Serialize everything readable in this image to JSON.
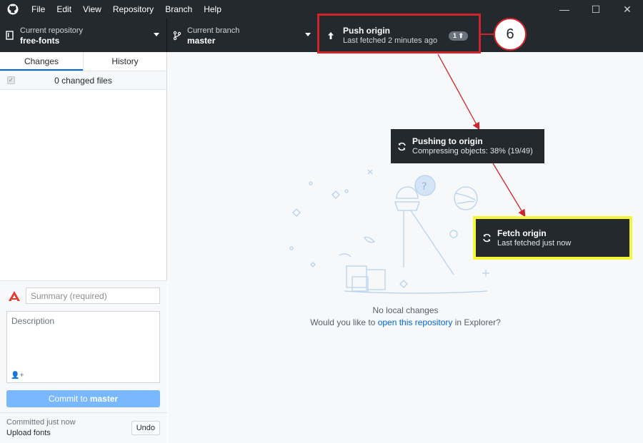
{
  "menu": [
    "File",
    "Edit",
    "View",
    "Repository",
    "Branch",
    "Help"
  ],
  "window_controls": {
    "minimize": "—",
    "maximize": "☐",
    "close": "✕"
  },
  "toolbar": {
    "repo_label": "Current repository",
    "repo_value": "free-fonts",
    "branch_label": "Current branch",
    "branch_value": "master",
    "push_title": "Push origin",
    "push_sub": "Last fetched 2 minutes ago",
    "push_badge": "1 ⬆"
  },
  "sidebar": {
    "tabs": [
      "Changes",
      "History"
    ],
    "changed_files": "0 changed files",
    "summary_placeholder": "Summary (required)",
    "description_placeholder": "Description",
    "coauthor_icon": "👤+",
    "commit_prefix": "Commit to ",
    "commit_branch": "master",
    "last_commit_time": "Committed just now",
    "last_commit_msg": "Upload fonts",
    "undo_label": "Undo"
  },
  "main": {
    "empty_line1": "No local changes",
    "empty_prefix": "Would you like to ",
    "empty_link": "open this repository",
    "empty_suffix": " in Explorer?"
  },
  "annotations": {
    "step_number": "6",
    "pushing_title": "Pushing to origin",
    "pushing_sub": "Compressing objects: 38% (19/49)",
    "fetch_title": "Fetch origin",
    "fetch_sub": "Last fetched just now"
  },
  "colors": {
    "accent_red": "#d0232a",
    "highlight_yellow": "#f5f53a",
    "dark_bar": "#24292e",
    "link_blue": "#0366d6"
  },
  "icons": {
    "app": "github-icon",
    "repo": "repo-icon",
    "branch": "git-branch-icon",
    "push": "arrow-up-icon",
    "sync": "sync-icon",
    "avatar": "user-avatar-icon"
  }
}
